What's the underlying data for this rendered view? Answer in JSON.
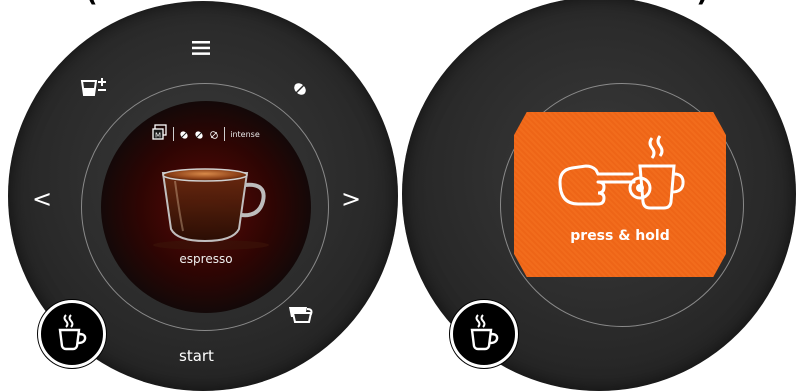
{
  "partial_top_text": "(                                                      )",
  "left_panel": {
    "menu_icon": "menu-icon",
    "cup_size_icon": "cup-size-plus-minus-icon",
    "strength_icon": "coffee-bean-icon",
    "nav_left": "<",
    "nav_right": ">",
    "double_cup_icon": "two-cups-icon",
    "start_label": "start",
    "screen": {
      "memory_icon": "memory-m-icon",
      "strength_text": "intense",
      "beans_filled": 2,
      "beans_total": 3,
      "drink_label": "espresso"
    },
    "brew_button_icon": "steaming-cup-icon"
  },
  "right_panel": {
    "screen": {
      "instruction_label": "press & hold",
      "illustration": "hand-pressing-cup-icon"
    },
    "brew_button_icon": "steaming-cup-icon"
  },
  "colors": {
    "dial": "#2a2a2a",
    "accent_orange": "#f26c1c",
    "screen_red": "#5a0a05",
    "text_white": "#ffffff"
  }
}
